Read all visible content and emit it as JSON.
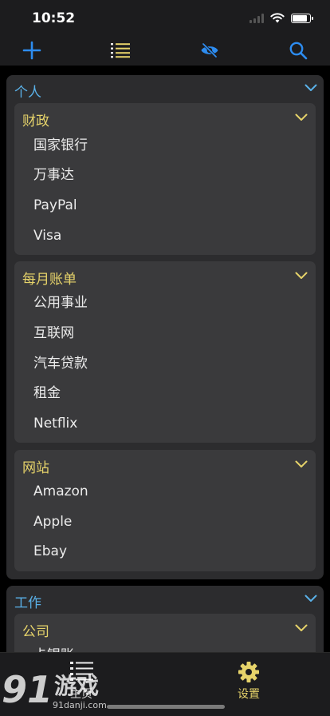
{
  "status_bar": {
    "time": "10:52"
  },
  "toolbar": {
    "add_icon": "plus-icon",
    "list_icon": "list-icon",
    "hide_icon": "eye-slash-icon",
    "search_icon": "search-icon",
    "accent_color": "#2d8cf0"
  },
  "groups": [
    {
      "title": "个人",
      "subgroups": [
        {
          "title": "财政",
          "items": [
            "国家银行",
            "万事达",
            "PayPal",
            "Visa"
          ]
        },
        {
          "title": "每月账单",
          "items": [
            "公用事业",
            "互联网",
            "汽车贷款",
            "租金",
            "Netflix"
          ]
        },
        {
          "title": "网站",
          "items": [
            "Amazon",
            "Apple",
            "Ebay"
          ]
        }
      ]
    },
    {
      "title": "工作",
      "subgroups": [
        {
          "title": "公司",
          "items": [
            "卡银账"
          ]
        }
      ]
    }
  ],
  "tabbar": {
    "tabs": [
      {
        "label": "主页",
        "icon": "list-icon"
      },
      {
        "label": "设置",
        "icon": "gear-icon"
      }
    ]
  },
  "watermark": {
    "brand_num": "91",
    "brand_cn": "游戏",
    "url": "91danji.com"
  },
  "colors": {
    "group_title": "#5ab1e8",
    "subgroup_title": "#e6d36a",
    "tab_active": "#e6d36a"
  }
}
